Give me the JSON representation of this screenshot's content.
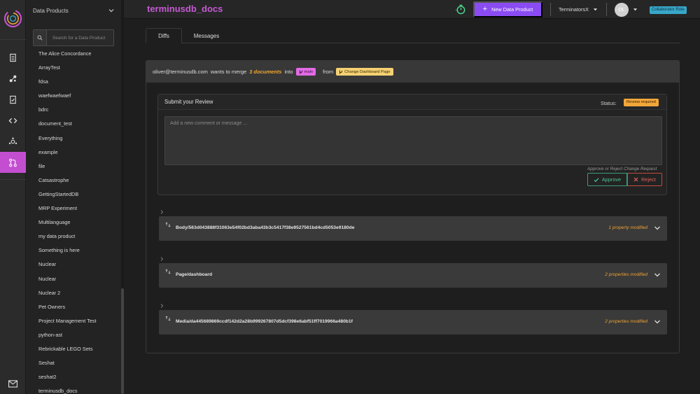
{
  "app": {
    "title": "terminusdb_docs"
  },
  "sidebar": {
    "header": "Data Products",
    "search_placeholder": "Search for a Data Product",
    "items": [
      "The Alice Concordance",
      "ArrayTest",
      "fdsa",
      "waefwaefwaef",
      "bdrc",
      "document_test",
      "Everything",
      "example",
      "file",
      "Catsastrophe",
      "GettingStartedDB",
      "MRP Experiment",
      "Multilanguage",
      "my data product",
      "Something is here",
      "Nuclear",
      "Nuclear",
      "Nuclear 2",
      "Pet Owners",
      "Project Management Test",
      "python-ast",
      "Rebrickable LEGO Sets",
      "Seshat",
      "seshat2",
      "terminusdb_docs"
    ]
  },
  "topbar": {
    "new_button": "New Data Product",
    "team": "TerminatorsX",
    "avatar_initials": "OL",
    "role": "Collaborator Role"
  },
  "tabs": {
    "diffs": "Diffs",
    "messages": "Messages"
  },
  "merge": {
    "user": "oliver@terminusdb.com",
    "wants_to_merge": "wants to merge",
    "docs_count": "3 documents",
    "into": "into",
    "target_branch": "main",
    "from": "from",
    "source_branch": "Change Dashboard Page"
  },
  "review": {
    "title": "Submit your Review",
    "status_label": "Status:",
    "status_value": "Review required",
    "comment_placeholder": "Add a new comment or message ...",
    "hint": "Approve or Reject Change Request",
    "approve_label": "Approve",
    "reject_label": "Reject"
  },
  "diffs": [
    {
      "name": "Body/563d043888f31063e54f02bd3aba43b3c5417f38e9527561bd4cd5053e9180de",
      "count": "1 property modified"
    },
    {
      "name": "Page/dashboard",
      "count": "2 properties modified"
    },
    {
      "name": "Media/da445689869ccdf142d2a28b999267807d5dcf398e6abf51ff7019966a480b1f",
      "count": "2 properties modified"
    }
  ],
  "colors": {
    "accent": "#c34fd0",
    "primary_button": "#8a4cf2",
    "modified": "#f0a334"
  }
}
